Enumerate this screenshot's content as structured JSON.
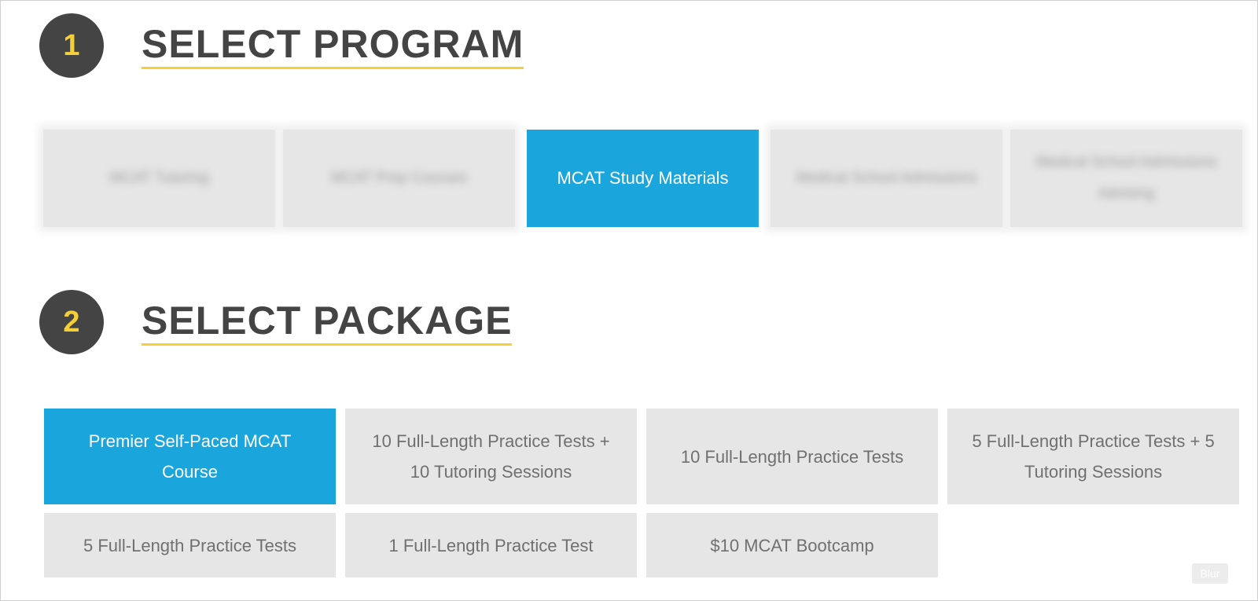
{
  "step1": {
    "number": "1",
    "title": "SELECT PROGRAM"
  },
  "programs": [
    {
      "label": "MCAT Tutoring",
      "selected": false,
      "blurred": true
    },
    {
      "label": "MCAT Prep Courses",
      "selected": false,
      "blurred": true
    },
    {
      "label": "MCAT Study Materials",
      "selected": true,
      "blurred": false
    },
    {
      "label": "Medical School Admissions",
      "selected": false,
      "blurred": true
    },
    {
      "label": "Medical School Admissions Advising",
      "selected": false,
      "blurred": true
    }
  ],
  "step2": {
    "number": "2",
    "title": "SELECT PACKAGE"
  },
  "packages": [
    {
      "label": "Premier Self-Paced MCAT Course",
      "selected": true
    },
    {
      "label": "10 Full-Length Practice Tests + 10 Tutoring Sessions",
      "selected": false
    },
    {
      "label": "10 Full-Length Practice Tests",
      "selected": false
    },
    {
      "label": "5 Full-Length Practice Tests + 5 Tutoring Sessions",
      "selected": false
    },
    {
      "label": "5 Full-Length Practice Tests",
      "selected": false
    },
    {
      "label": "1 Full-Length Practice Test",
      "selected": false
    },
    {
      "label": "$10 MCAT Bootcamp",
      "selected": false
    }
  ],
  "blur_button": {
    "label": "Blur"
  },
  "colors": {
    "accent": "#1ba5dd",
    "step_circle": "#444444",
    "step_number": "#f4cf3a",
    "underline": "#f4cf3a",
    "tile_bg": "#e6e6e6",
    "tile_text": "#707070"
  }
}
